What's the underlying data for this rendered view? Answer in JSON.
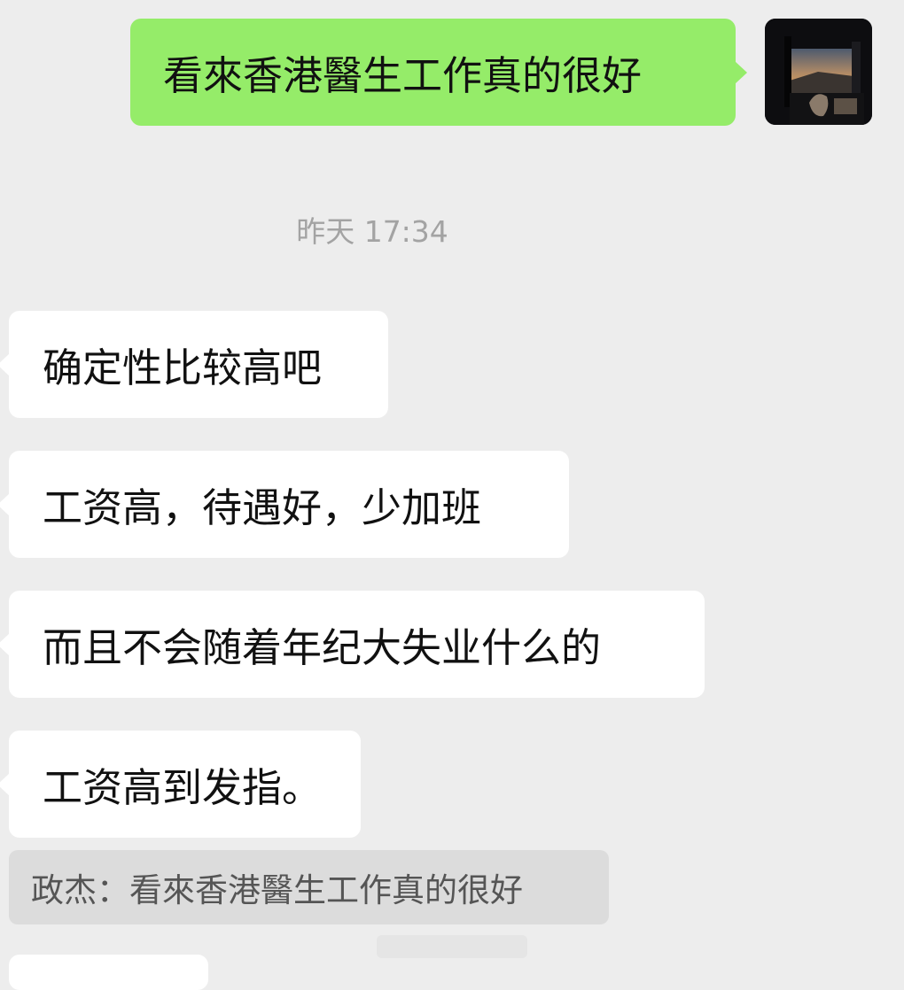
{
  "outgoing": {
    "text": "看來香港醫生工作真的很好"
  },
  "timestamp": "昨天 17:34",
  "incoming": [
    "确定性比较高吧",
    "工资高，待遇好，少加班",
    "而且不会随着年纪大失业什么的",
    "工资高到发指。"
  ],
  "quote": {
    "text": "政杰：看來香港醫生工作真的很好"
  },
  "colors": {
    "background": "#ededed",
    "outgoing_bubble": "#95ec69",
    "incoming_bubble": "#ffffff",
    "quote_bg": "#dcdcdc",
    "timestamp_text": "#a3a3a3"
  }
}
